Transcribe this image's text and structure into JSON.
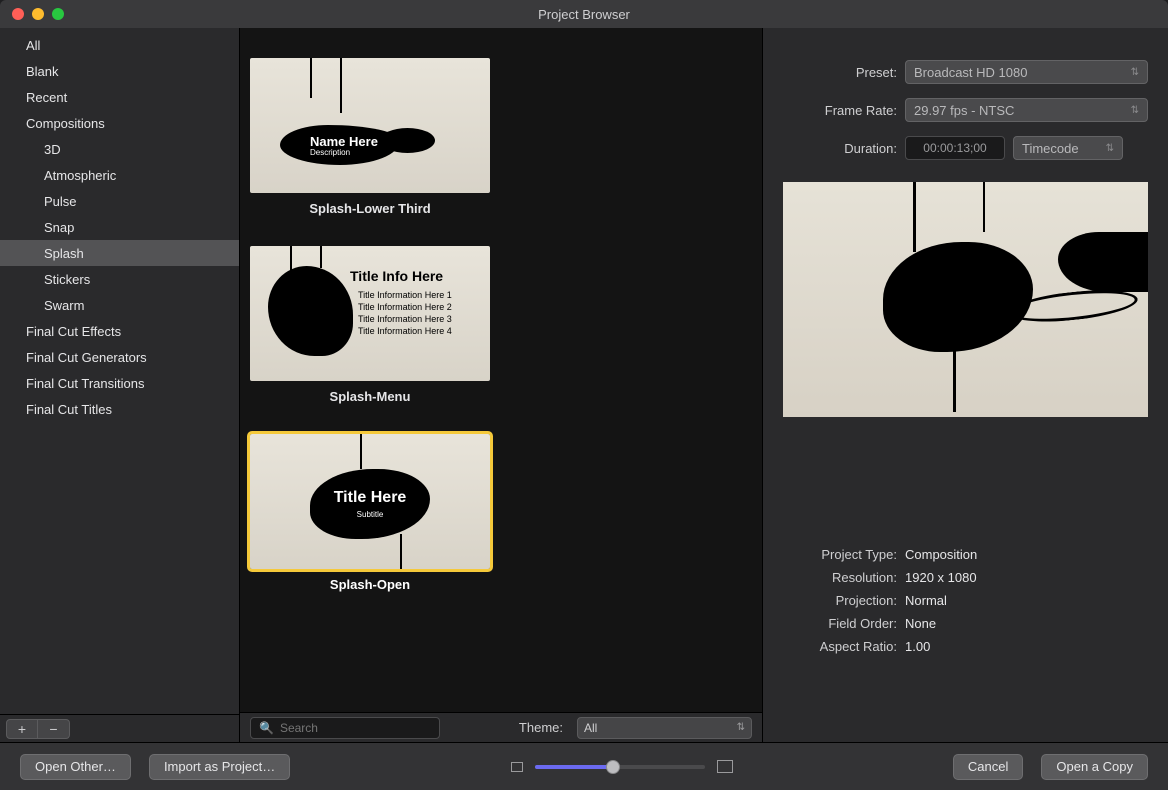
{
  "window": {
    "title": "Project Browser"
  },
  "sidebar": {
    "items": [
      {
        "label": "All",
        "child": false
      },
      {
        "label": "Blank",
        "child": false
      },
      {
        "label": "Recent",
        "child": false
      },
      {
        "label": "Compositions",
        "child": false
      },
      {
        "label": "3D",
        "child": true
      },
      {
        "label": "Atmospheric",
        "child": true
      },
      {
        "label": "Pulse",
        "child": true
      },
      {
        "label": "Snap",
        "child": true
      },
      {
        "label": "Splash",
        "child": true,
        "selected": true
      },
      {
        "label": "Stickers",
        "child": true
      },
      {
        "label": "Swarm",
        "child": true
      },
      {
        "label": "Final Cut Effects",
        "child": false
      },
      {
        "label": "Final Cut Generators",
        "child": false
      },
      {
        "label": "Final Cut Transitions",
        "child": false
      },
      {
        "label": "Final Cut Titles",
        "child": false
      }
    ],
    "add": "+",
    "remove": "−"
  },
  "templates": {
    "t0": {
      "label": "Splash-Lower Third",
      "overlay": {
        "name": "Name Here",
        "desc": "Description"
      }
    },
    "t1": {
      "label": "Splash-Menu",
      "overlay": {
        "title": "Title Info Here",
        "line1": "Title Information Here 1",
        "line2": "Title Information Here 2",
        "line3": "Title Information Here 3",
        "line4": "Title Information Here 4"
      }
    },
    "t2": {
      "label": "Splash-Open",
      "selected": true,
      "overlay": {
        "title": "Title Here",
        "sub": "Subtitle"
      }
    }
  },
  "search": {
    "placeholder": "Search"
  },
  "theme": {
    "label": "Theme:",
    "value": "All"
  },
  "inspector": {
    "preset": {
      "label": "Preset:",
      "value": "Broadcast HD 1080"
    },
    "frameRate": {
      "label": "Frame Rate:",
      "value": "29.97 fps - NTSC"
    },
    "duration": {
      "label": "Duration:",
      "value": "00:00:13;00",
      "mode": "Timecode"
    },
    "meta": {
      "projectType": {
        "label": "Project Type:",
        "value": "Composition"
      },
      "resolution": {
        "label": "Resolution:",
        "value": "1920 x 1080"
      },
      "projection": {
        "label": "Projection:",
        "value": "Normal"
      },
      "fieldOrder": {
        "label": "Field Order:",
        "value": "None"
      },
      "aspectRatio": {
        "label": "Aspect Ratio:",
        "value": "1.00"
      }
    }
  },
  "footer": {
    "openOther": "Open Other…",
    "importAsProject": "Import as Project…",
    "cancel": "Cancel",
    "openCopy": "Open a Copy"
  }
}
